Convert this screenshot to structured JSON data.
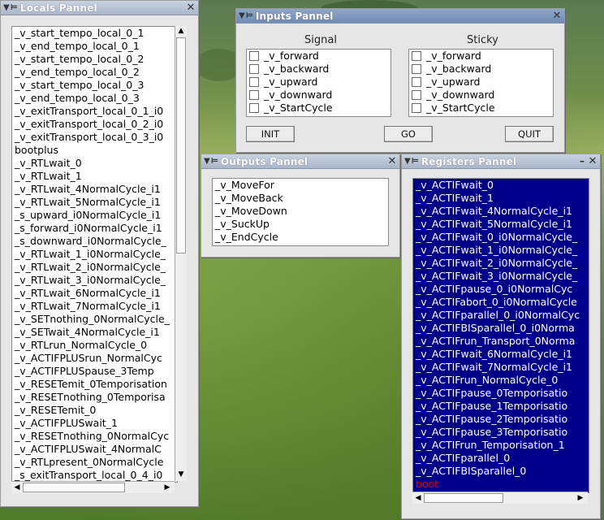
{
  "locals": {
    "title": "Locals Pannel",
    "items": [
      "_v_start_tempo_local_0_1",
      "_v_end_tempo_local_0_1",
      "_v_start_tempo_local_0_2",
      "_v_end_tempo_local_0_2",
      "_v_start_tempo_local_0_3",
      "_v_end_tempo_local_0_3",
      "_v_exitTransport_local_0_1_i0",
      "_v_exitTransport_local_0_2_i0",
      "_v_exitTransport_local_0_3_i0",
      "bootplus",
      "_v_RTLwait_0",
      "_v_RTLwait_1",
      "_v_RTLwait_4NormalCycle_i1",
      "_v_RTLwait_5NormalCycle_i1",
      "_s_upward_i0NormalCycle_i1",
      "_s_forward_i0NormalCycle_i1",
      "_s_downward_i0NormalCycle_",
      "_v_RTLwait_1_i0NormalCycle_",
      "_v_RTLwait_2_i0NormalCycle_",
      "_v_RTLwait_3_i0NormalCycle_",
      "_v_RTLwait_6NormalCycle_i1",
      "_v_RTLwait_7NormalCycle_i1",
      "_v_SETnothing_0NormalCycle_",
      "_v_SETwait_4NormalCycle_i1",
      "_v_RTLrun_NormalCycle_0",
      "_v_ACTIFPLUSrun_NormalCyc",
      "_v_ACTIFPLUSpause_3Temp",
      "_v_RESETemit_0Temporisation",
      "_v_RESETnothing_0Temporisa",
      "_v_RESETemit_0",
      "_v_ACTIFPLUSwait_1",
      "_v_RESETnothing_0NormalCyc",
      "_v_ACTIFPLUSwait_4NormalC",
      "_v_RTLpresent_0NormalCycle",
      "_s_exitTransport_local_0_4_i0"
    ]
  },
  "inputs": {
    "title": "Inputs Pannel",
    "signal_header": "Signal",
    "sticky_header": "Sticky",
    "signals": [
      "_v_forward",
      "_v_backward",
      "_v_upward",
      "_v_downward",
      "_v_StartCycle"
    ],
    "sticky": [
      "_v_forward",
      "_v_backward",
      "_v_upward",
      "_v_downward",
      "_v_StartCycle"
    ],
    "buttons": {
      "init": "INIT",
      "go": "GO",
      "quit": "QUIT"
    }
  },
  "outputs": {
    "title": "Outputs Pannel",
    "items": [
      "_v_MoveFor",
      "_v_MoveBack",
      "_v_MoveDown",
      "_v_SuckUp",
      "_v_EndCycle"
    ]
  },
  "registers": {
    "title": "Registers Pannel",
    "items": [
      "_v_ACTIFwait_0",
      "_v_ACTIFwait_1",
      "_v_ACTIFwait_4NormalCycle_i1",
      "_v_ACTIFwait_5NormalCycle_i1",
      "_v_ACTIFwait_0_i0NormalCycle_",
      "_v_ACTIFwait_1_i0NormalCycle_",
      "_v_ACTIFwait_2_i0NormalCycle_",
      "_v_ACTIFwait_3_i0NormalCycle_",
      "_v_ACTIFpause_0_i0NormalCyc",
      "_v_ACTIFabort_0_i0NormalCycle",
      "_v_ACTIFparallel_0_i0NormalCyc",
      "_v_ACTIFBISparallel_0_i0Norma",
      "_v_ACTIFrun_Transport_0Norma",
      "_v_ACTIFwait_6NormalCycle_i1",
      "_v_ACTIFwait_7NormalCycle_i1",
      "_v_ACTIFrun_NormalCycle_0",
      "_v_ACTIFpause_0Temporisatio",
      "_v_ACTIFpause_1Temporisatio",
      "_v_ACTIFpause_2Temporisatio",
      "_v_ACTIFpause_3Temporisatio",
      "_v_ACTIFrun_Temporisation_1",
      "_v_ACTIFparallel_0",
      "_v_ACTIFBISparallel_0"
    ],
    "last_item": "boot"
  },
  "icons": {
    "menu": "window-menu-icon",
    "pin": "pin-icon",
    "close": "close-icon",
    "minimize": "minimize-icon",
    "arrow_up": "scroll-up-arrow-icon",
    "arrow_down": "scroll-down-arrow-icon",
    "arrow_left": "scroll-left-arrow-icon",
    "arrow_right": "scroll-right-arrow-icon"
  },
  "colors": {
    "selection_bg": "#00008b",
    "selection_fg": "#ffffff",
    "highlight_text": "#e00000"
  }
}
